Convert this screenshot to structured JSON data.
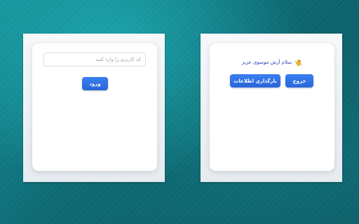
{
  "login_panel": {
    "username_placeholder": "کد کاربری را وارد کنید",
    "username_value": "",
    "login_button": "ورود"
  },
  "user_panel": {
    "greeting": "سلام آرش موسوی عزیز",
    "greeting_icon": "waving-hand-icon",
    "reload_button": "بارگذاری اطلاعات",
    "logout_button": "خروج"
  },
  "colors": {
    "accent": "#2f6fe4",
    "greeting_text": "#1f3fb8",
    "background": "#0e7a84"
  }
}
